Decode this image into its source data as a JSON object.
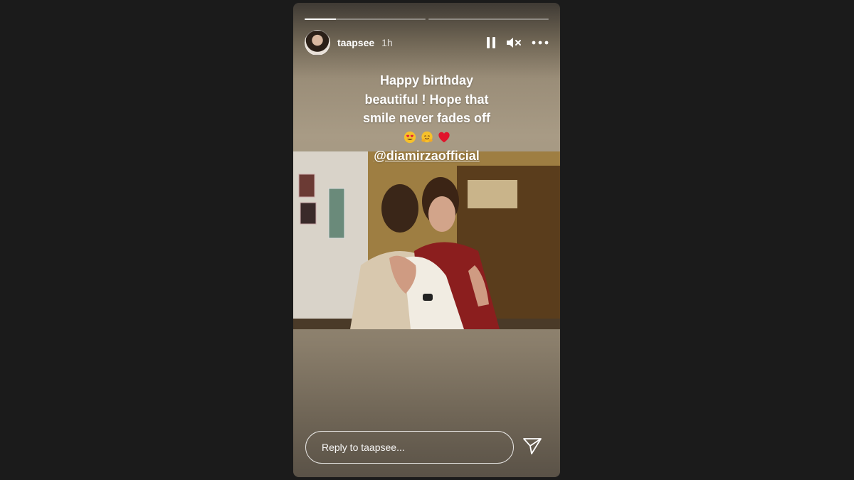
{
  "story": {
    "progress": [
      0.26,
      0.0
    ],
    "user": {
      "username": "taapsee",
      "time": "1h"
    },
    "controls": {
      "pause_icon": "pause-icon",
      "mute_icon": "muted-speaker-icon",
      "more_icon": "more-horizontal-icon"
    },
    "caption": {
      "lines": [
        "Happy birthday",
        "beautiful ! Hope that",
        "smile never fades off"
      ],
      "emojis": [
        "heart-eyes-emoji",
        "hugging-face-emoji",
        "red-heart-emoji"
      ],
      "mention": "@diamirzaofficial"
    },
    "photo": {
      "description_icon": "two-women-hugging-photo"
    },
    "reply": {
      "placeholder": "Reply to taapsee...",
      "send_icon": "send-icon"
    }
  }
}
